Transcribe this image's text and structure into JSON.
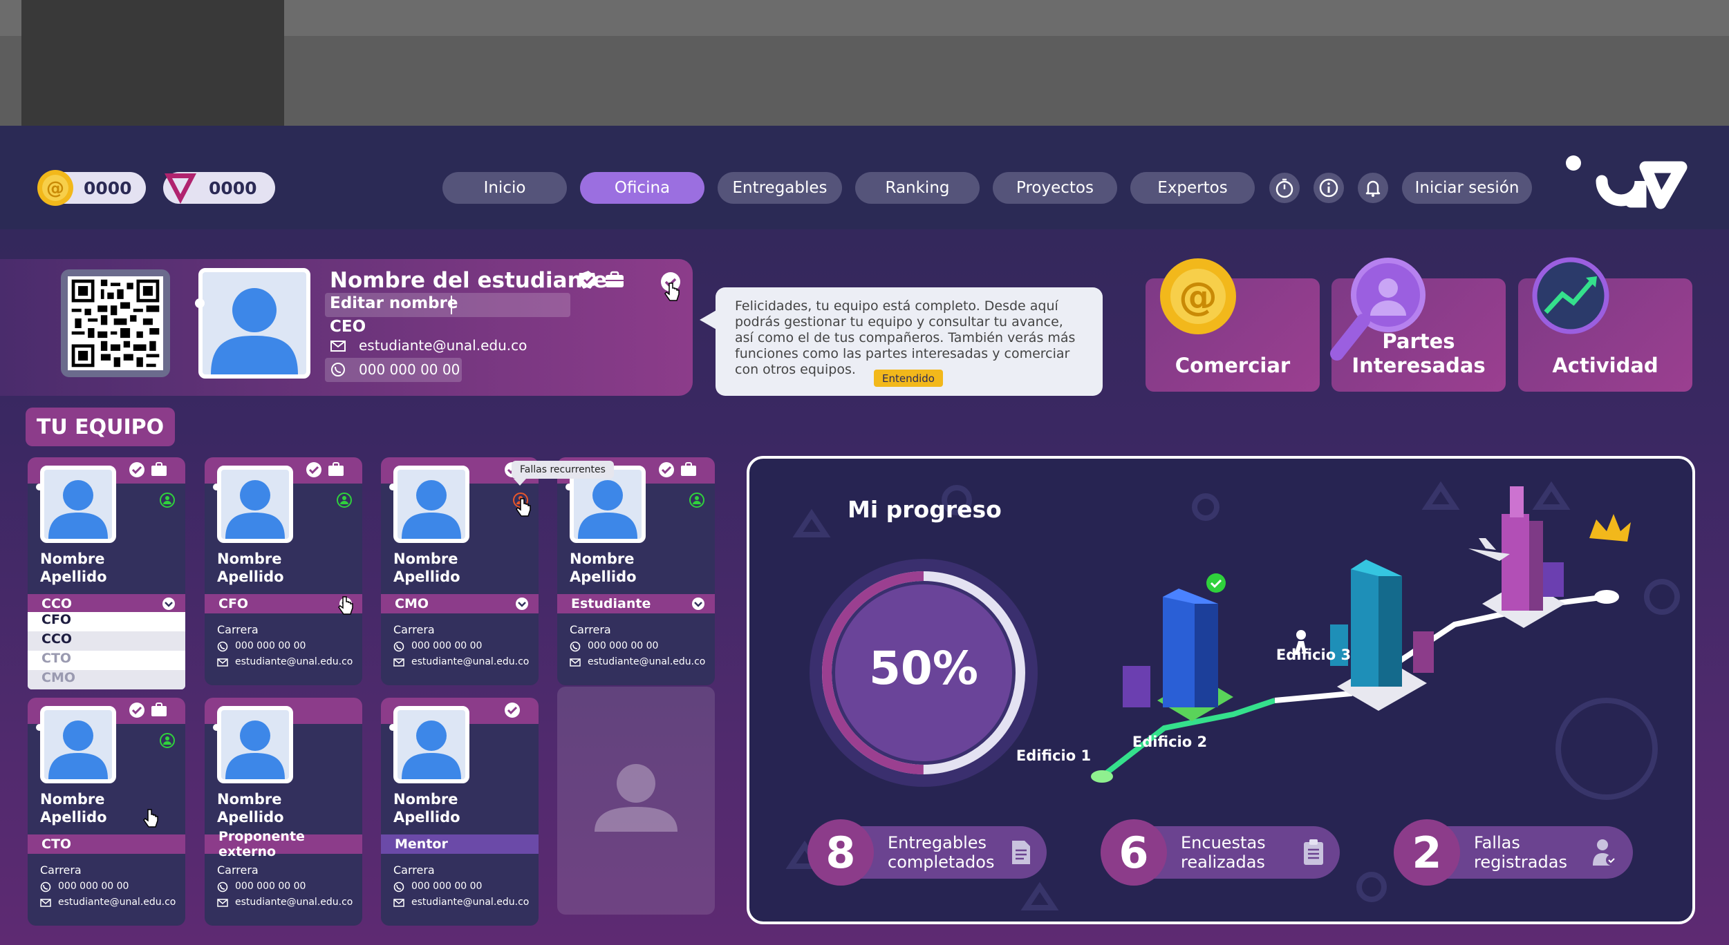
{
  "currency": {
    "coins_a": "0000",
    "coins_v": "0000"
  },
  "nav": {
    "items": [
      "Inicio",
      "Oficina",
      "Entregables",
      "Ranking",
      "Proyectos",
      "Expertos"
    ],
    "active": "Oficina",
    "login": "Iniciar sesión",
    "logo": "a v"
  },
  "profile": {
    "name": "Nombre del estudiante",
    "edit_placeholder": "Editar nombre",
    "role": "CEO",
    "email": "estudiante@unal.edu.co",
    "phone": "000 000 00 00"
  },
  "tooltip": {
    "text": "Felicidades, tu equipo está completo. Desde aquí podrás gestionar tu equipo y consultar tu avance, así como el de tus compañeros. También verás más funciones como las partes interesadas y comerciar con otros equipos.",
    "button": "Entendido"
  },
  "tiles": {
    "trade": "Comerciar",
    "stakeholders_1": "Partes",
    "stakeholders_2": "Interesadas",
    "activity": "Actividad"
  },
  "team": {
    "title": "TU EQUIPO",
    "hover_tooltip": "Fallas recurrentes",
    "dropdown_options": [
      "CFO",
      "CCO",
      "CTO",
      "CMO"
    ],
    "members": [
      {
        "name1": "Nombre",
        "name2": "Apellido",
        "role": "CCO",
        "career": "",
        "phone": "",
        "email": ""
      },
      {
        "name1": "Nombre",
        "name2": "Apellido",
        "role": "CFO",
        "career": "Carrera",
        "phone": "000 000 00 00",
        "email": "estudiante@unal.edu.co"
      },
      {
        "name1": "Nombre",
        "name2": "Apellido",
        "role": "CMO",
        "career": "Carrera",
        "phone": "000 000 00 00",
        "email": "estudiante@unal.edu.co"
      },
      {
        "name1": "Nombre",
        "name2": "Apellido",
        "role": "Estudiante",
        "career": "Carrera",
        "phone": "000 000 00 00",
        "email": "estudiante@unal.edu.co"
      },
      {
        "name1": "Nombre",
        "name2": "Apellido",
        "role": "CTO",
        "career": "Carrera",
        "phone": "000 000 00 00",
        "email": "estudiante@unal.edu.co"
      },
      {
        "name1": "Nombre",
        "name2": "Apellido",
        "role": "Proponente externo",
        "career": "Carrera",
        "phone": "000 000 00 00",
        "email": "estudiante@unal.edu.co"
      },
      {
        "name1": "Nombre",
        "name2": "Apellido",
        "role": "Mentor",
        "career": "Carrera",
        "phone": "000 000 00 00",
        "email": "estudiante@unal.edu.co"
      }
    ]
  },
  "progress": {
    "title": "Mi progreso",
    "percent_label": "50%",
    "percent": 0.5,
    "buildings": [
      "Edificio 1",
      "Edificio 2",
      "Edificio 3"
    ],
    "stats": [
      {
        "value": "8",
        "l1": "Entregables",
        "l2": "completados"
      },
      {
        "value": "6",
        "l1": "Encuestas",
        "l2": "realizadas"
      },
      {
        "value": "2",
        "l1": "Fallas",
        "l2": "registradas"
      }
    ]
  },
  "colors": {
    "bg": "#2b2a55",
    "accent": "#8c3c8a",
    "active_nav": "#9b6fe0",
    "gold": "#f2b81b",
    "green": "#2fd13c"
  }
}
